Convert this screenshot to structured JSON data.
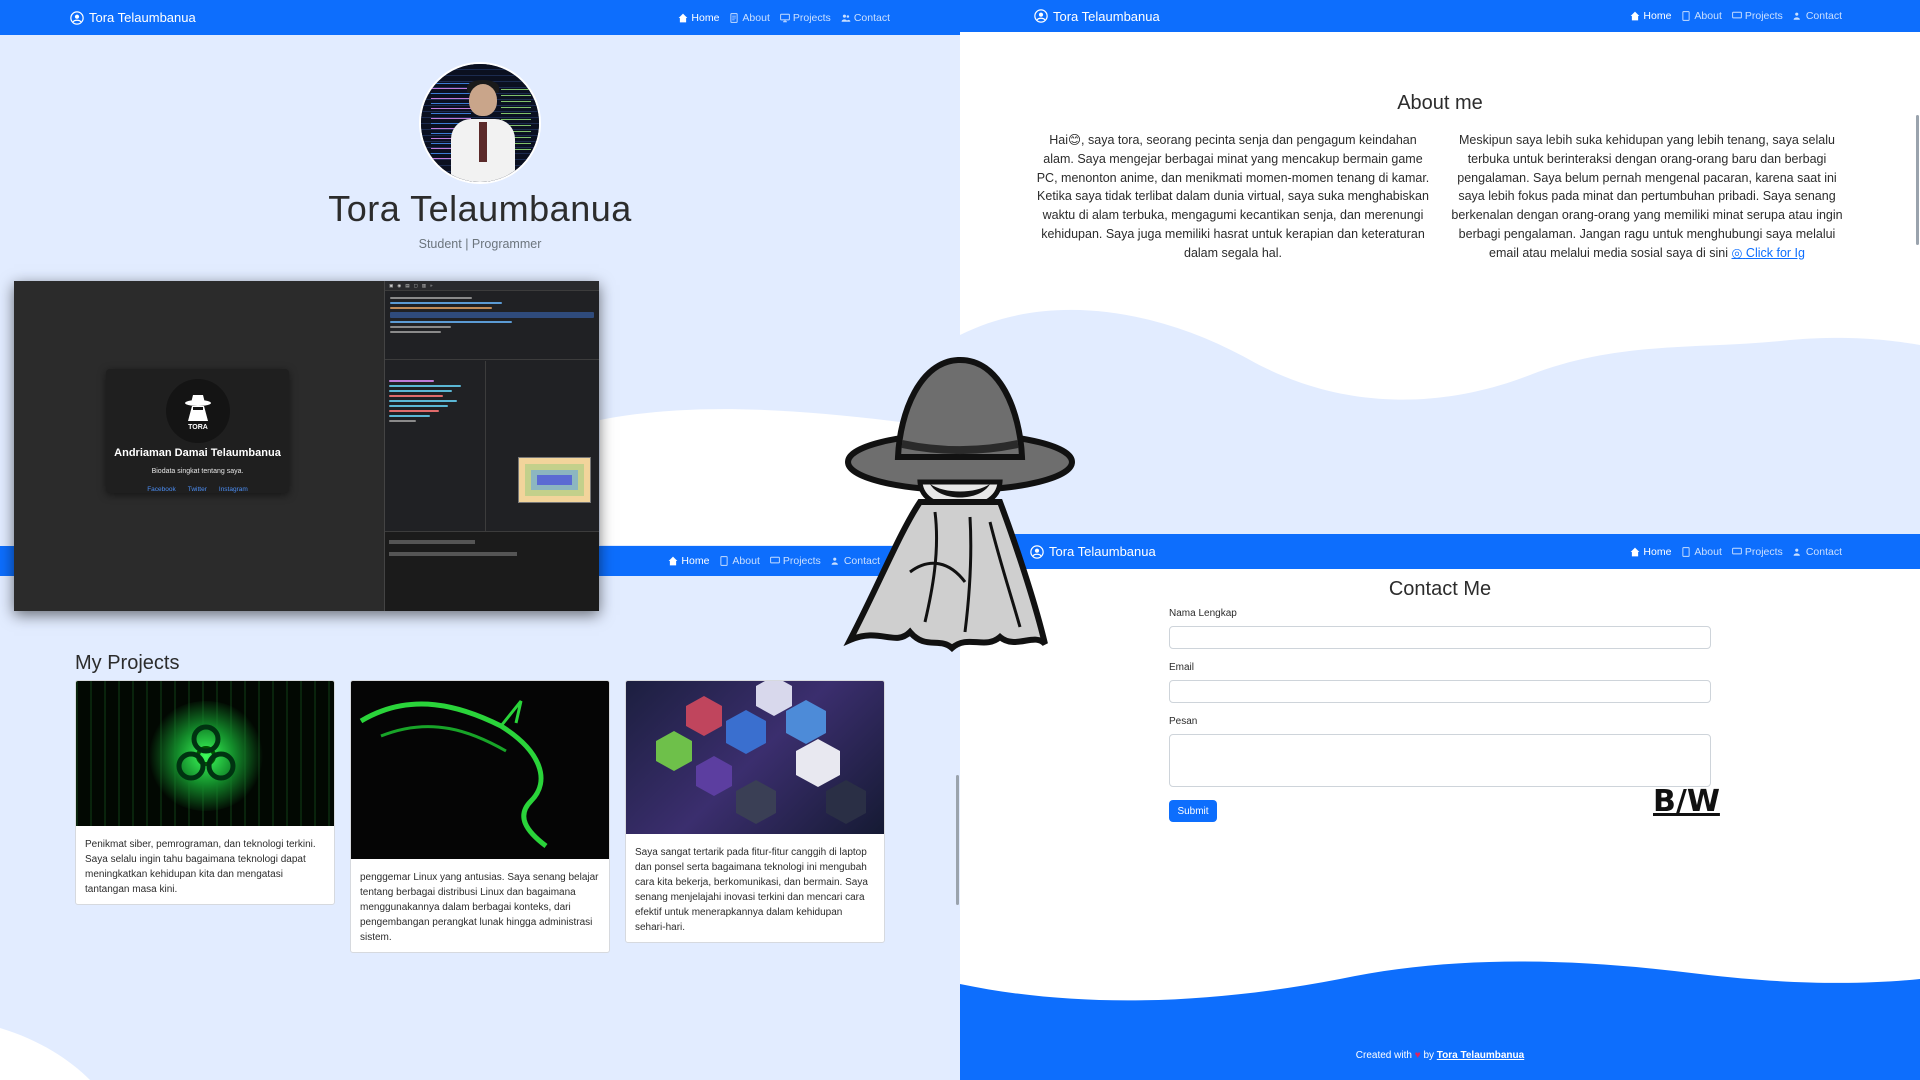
{
  "nav": {
    "brand": "Tora Telaumbanua",
    "items": [
      "Home",
      "About",
      "Projects",
      "Contact"
    ]
  },
  "hero": {
    "name": "Tora Telaumbanua",
    "subtitle": "Student | Programmer"
  },
  "screenshot_card": {
    "name": "Andriaman Damai Telaumbanua",
    "bio": "Biodata singkat tentang saya.",
    "links": [
      "Facebook",
      "Twitter",
      "Instagram"
    ],
    "logo_text": "TORA"
  },
  "projects": {
    "title": "My Projects",
    "cards": [
      {
        "text": "Penikmat siber, pemrograman, dan teknologi terkini. Saya selalu ingin tahu bagaimana teknologi dapat meningkatkan kehidupan kita dan mengatasi tantangan masa kini."
      },
      {
        "text": "penggemar Linux yang antusias. Saya senang belajar tentang berbagai distribusi Linux dan bagaimana menggunakannya dalam berbagai konteks, dari pengembangan perangkat lunak hingga administrasi sistem."
      },
      {
        "text": "Saya sangat tertarik pada fitur-fitur canggih di laptop dan ponsel serta bagaimana teknologi ini mengubah cara kita bekerja, berkomunikasi, dan bermain. Saya senang menjelajahi inovasi terkini dan mencari cara efektif untuk menerapkannya dalam kehidupan sehari-hari."
      }
    ]
  },
  "about": {
    "title": "About me",
    "left": "Hai😊, saya tora, seorang pecinta senja dan pengagum keindahan alam. Saya mengejar berbagai minat yang mencakup bermain game PC, menonton anime, dan menikmati momen-momen tenang di kamar. Ketika saya tidak terlibat dalam dunia virtual, saya suka menghabiskan waktu di alam terbuka, mengagumi kecantikan senja, dan merenungi kehidupan. Saya juga memiliki hasrat untuk kerapian dan keteraturan dalam segala hal.",
    "right": "Meskipun saya lebih suka kehidupan yang lebih tenang, saya selalu terbuka untuk berinteraksi dengan orang-orang baru dan berbagi pengalaman. Saya belum pernah mengenal pacaran, karena saat ini saya lebih fokus pada minat dan pertumbuhan pribadi. Saya senang berkenalan dengan orang-orang yang memiliki minat serupa atau ingin berbagi pengalaman. Jangan ragu untuk menghubungi saya melalui email atau melalui media sosial saya di sini",
    "ig_link": "Click for Ig"
  },
  "contact": {
    "title": "Contact Me",
    "name_label": "Nama Lengkap",
    "email_label": "Email",
    "message_label": "Pesan",
    "submit": "Submit",
    "toggle": "B/W"
  },
  "footer": {
    "prefix": "Created with",
    "by": "by",
    "author": "Tora Telaumbanua"
  },
  "colors": {
    "primary": "#0d6efd",
    "light_bg": "#e2ecff"
  }
}
